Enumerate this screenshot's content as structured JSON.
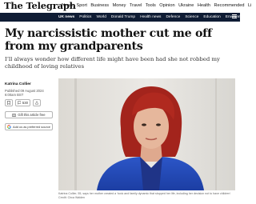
{
  "brand": {
    "logo": "The Telegraph"
  },
  "nav": {
    "main": [
      "News",
      "Sport",
      "Business",
      "Money",
      "Travel",
      "Tools",
      "Opinion",
      "Ukraine",
      "Health",
      "Recommended"
    ],
    "overflow": "Li",
    "sub": [
      "UK news",
      "Politics",
      "World",
      "Donald Trump",
      "Health news",
      "Defence",
      "Science",
      "Education",
      "Environment"
    ]
  },
  "article": {
    "headline": "My narcissistic mother cut me off from my grandparents",
    "standfirst": "I’ll always wonder how different life might have been had she not robbed my childhood of loving relatives",
    "author": "Katrina Collier",
    "published": "Published 09 August 2024",
    "time": "6:00am BST",
    "comments_count": "530",
    "gift_label": "Gift this article free",
    "preferred_label": "Add us as preferred source",
    "caption": "Katrina Collier, 55, says her mother created a ‘toxic and family dynamic that stopped her life, including her decision not to have children’ Credit: Circa Walden"
  },
  "icons": [
    "bookmark-icon",
    "comment-icon",
    "share-icon",
    "gift-icon",
    "google-icon",
    "menu-icon"
  ],
  "colors": {
    "subnav_bg": "#0f1c34",
    "text": "#121212"
  }
}
